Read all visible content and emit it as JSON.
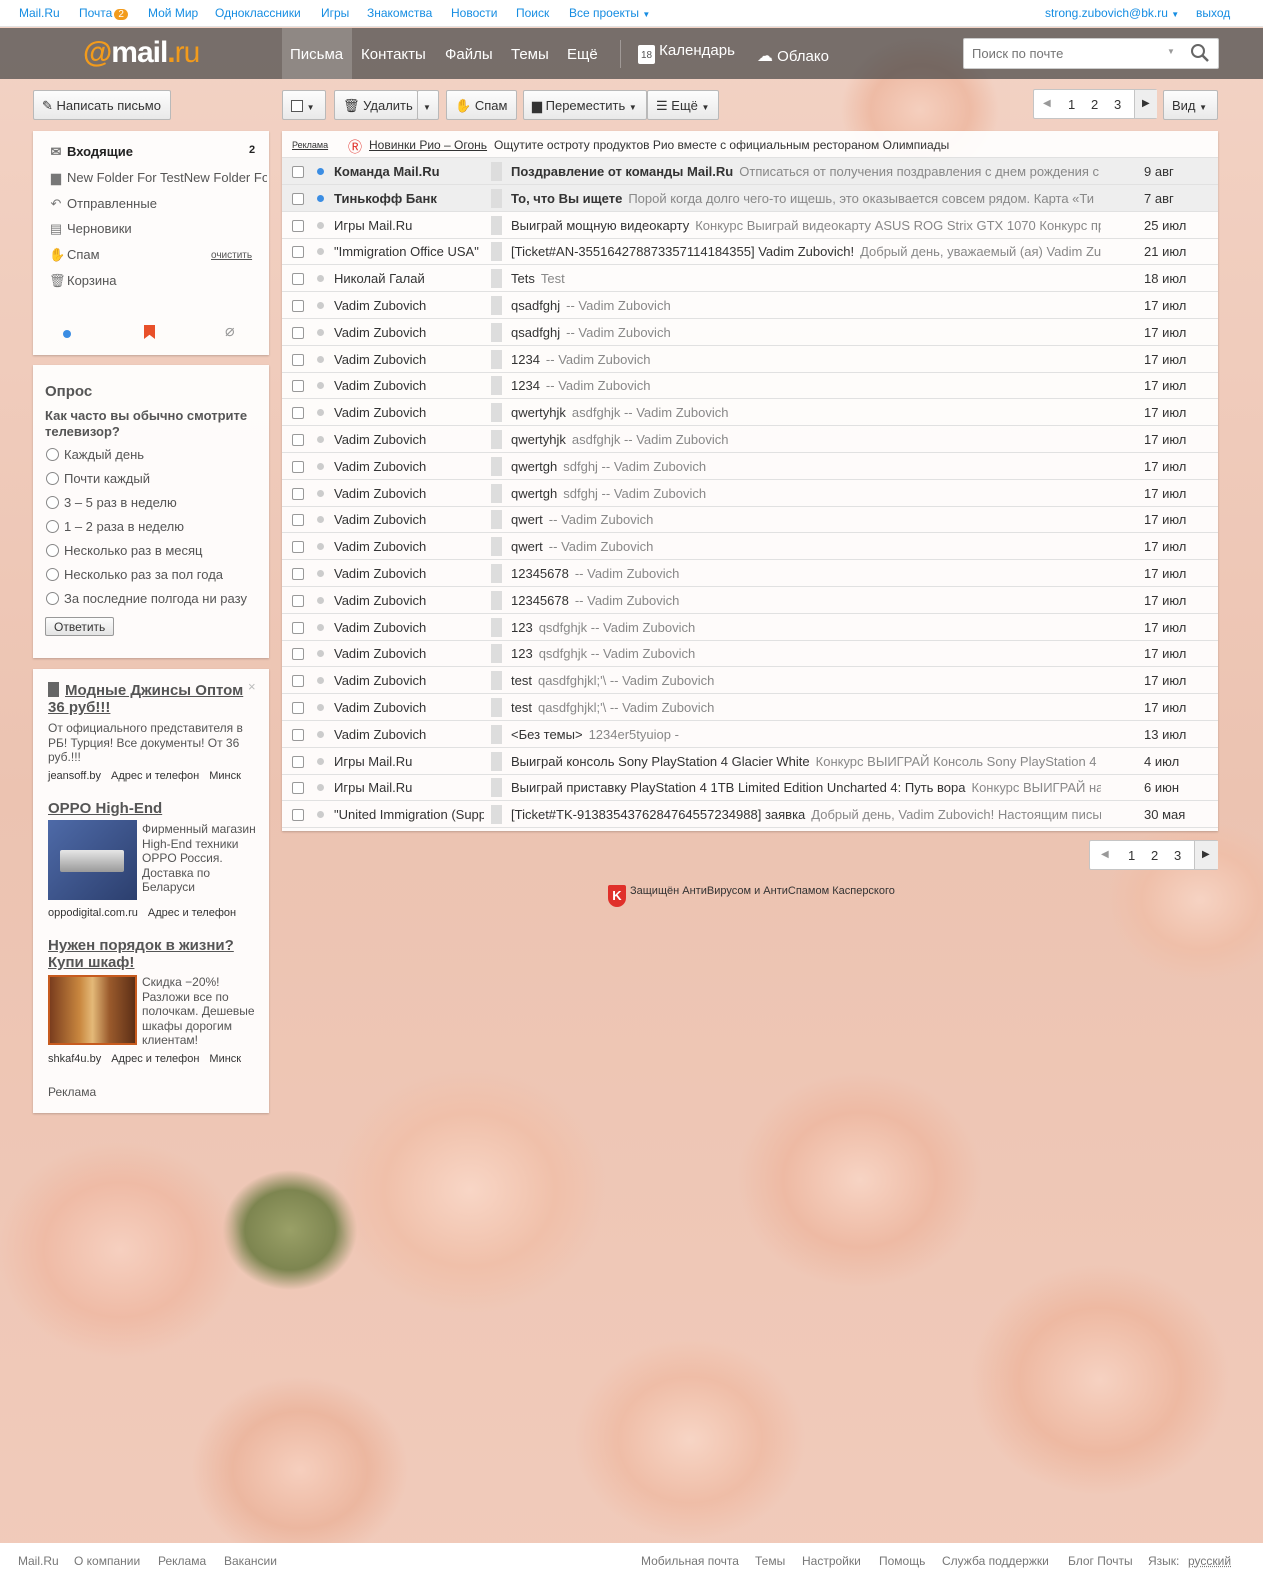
{
  "topbar": {
    "mailru": "Mail.Ru",
    "pochta": "Почта",
    "pochta_count": "2",
    "moy_mir": "Мой Мир",
    "ok": "Одноклассники",
    "igry": "Игры",
    "znakomstva": "Знакомства",
    "novosti": "Новости",
    "poisk": "Поиск",
    "vse_proekty": "Все проекты",
    "user": "strong.zubovich@bk.ru",
    "logout": "выход"
  },
  "header": {
    "logo_at": "@",
    "logo_mail": "mail",
    "logo_dot": ".",
    "logo_ru": "ru",
    "nav": [
      "Письма",
      "Контакты",
      "Файлы",
      "Темы",
      "Ещё"
    ],
    "calendar": "Календарь",
    "calendar_day": "18",
    "cloud": "Облако",
    "search_placeholder": "Поиск по почте"
  },
  "toolbar": {
    "compose": "Написать письмо",
    "delete": "Удалить",
    "spam": "Спам",
    "move": "Переместить",
    "more": "Ещё",
    "view": "Вид",
    "pages": [
      "1",
      "2",
      "3"
    ]
  },
  "folders": [
    {
      "icon": "envelope-icon",
      "label": "Входящие",
      "count": "2"
    },
    {
      "icon": "folder-icon",
      "label": "New Folder For TestNew Folder For Test"
    },
    {
      "icon": "reply-icon",
      "label": "Отправленные"
    },
    {
      "icon": "draft-icon",
      "label": "Черновики"
    },
    {
      "icon": "spam-icon",
      "label": "Спам",
      "action": "очистить"
    },
    {
      "icon": "trash-icon",
      "label": "Корзина"
    }
  ],
  "poll": {
    "title": "Опрос",
    "question": "Как часто вы обычно смотрите телевизор?",
    "options": [
      "Каждый день",
      "Почти каждый",
      "3 – 5 раз в неделю",
      "1 – 2 раза в неделю",
      "Несколько раз в месяц",
      "Несколько раз за пол года",
      "За последние полгода ни разу"
    ],
    "submit": "Ответить"
  },
  "ads": [
    {
      "title": "Модные Джинсы Оптом 36 руб!!!",
      "text": "От официального представителя в РБ! Турция! Все документы! От 36 руб.!!!",
      "site": "jeansoff.by",
      "addr": "Адрес и телефон",
      "city": "Минск"
    },
    {
      "title": "OPPO High-End",
      "text": "Фирменный магазин High-End техники OPPO Россия. Доставка по Беларуси",
      "site": "oppodigital.com.ru",
      "addr": "Адрес и телефон"
    },
    {
      "title": "Нужен порядок в жизни? Купи шкаф!",
      "text": "Скидка −20%! Разложи все по полочкам. Дешевые шкафы дорогим клиентам!",
      "site": "shkaf4u.by",
      "addr": "Адрес и телефон",
      "city": "Минск"
    }
  ],
  "ads_label": "Реклама",
  "promo": {
    "label": "Реклама",
    "link": "Новинки Рио – Огонь",
    "text": "Ощутите остроту продуктов Рио вместе с официальным рестораном Олимпиады"
  },
  "messages": [
    {
      "from": "Команда Mail.Ru",
      "subject": "Поздравление от команды Mail.Ru",
      "snippet": "Отписаться от получения поздравления с днем рождения с",
      "date": "9 авг",
      "unread": true
    },
    {
      "from": "Тинькофф Банк",
      "subject": "То, что Вы ищете",
      "snippet": "Порой когда долго чего-то ищешь, это оказывается совсем рядом. Карта «Ти",
      "date": "7 авг",
      "unread": true
    },
    {
      "from": "Игры Mail.Ru",
      "subject": "Выиграй мощную видеокарту",
      "snippet": "Конкурс Выиграй видеокарту ASUS ROG Strix GTX 1070 Конкурс пр",
      "date": "25 июл",
      "unread": false
    },
    {
      "from": "\"Immigration Office USA\"",
      "subject": "[Ticket#AN-3551642788733571141843​55] Vadim Zubovich!",
      "snippet": "Добрый день, уважаемый (ая) Vadim Zubo",
      "date": "21 июл",
      "unread": false
    },
    {
      "from": "Николай Галай",
      "subject": "Tets",
      "snippet": "Test",
      "date": "18 июл",
      "unread": false
    },
    {
      "from": "Vadim Zubovich",
      "subject": "qsadfghj",
      "snippet": "-- Vadim Zubovich",
      "date": "17 июл",
      "unread": false
    },
    {
      "from": "Vadim Zubovich",
      "subject": "qsadfghj",
      "snippet": "-- Vadim Zubovich",
      "date": "17 июл",
      "unread": false
    },
    {
      "from": "Vadim Zubovich",
      "subject": "1234",
      "snippet": "-- Vadim Zubovich",
      "date": "17 июл",
      "unread": false
    },
    {
      "from": "Vadim Zubovich",
      "subject": "1234",
      "snippet": "-- Vadim Zubovich",
      "date": "17 июл",
      "unread": false
    },
    {
      "from": "Vadim Zubovich",
      "subject": "qwertyhjk",
      "snippet": "asdfghjk -- Vadim Zubovich",
      "date": "17 июл",
      "unread": false
    },
    {
      "from": "Vadim Zubovich",
      "subject": "qwertyhjk",
      "snippet": "asdfghjk -- Vadim Zubovich",
      "date": "17 июл",
      "unread": false
    },
    {
      "from": "Vadim Zubovich",
      "subject": "qwertgh",
      "snippet": "sdfghj -- Vadim Zubovich",
      "date": "17 июл",
      "unread": false
    },
    {
      "from": "Vadim Zubovich",
      "subject": "qwertgh",
      "snippet": "sdfghj -- Vadim Zubovich",
      "date": "17 июл",
      "unread": false
    },
    {
      "from": "Vadim Zubovich",
      "subject": "qwert",
      "snippet": "-- Vadim Zubovich",
      "date": "17 июл",
      "unread": false
    },
    {
      "from": "Vadim Zubovich",
      "subject": "qwert",
      "snippet": "-- Vadim Zubovich",
      "date": "17 июл",
      "unread": false
    },
    {
      "from": "Vadim Zubovich",
      "subject": "12345678",
      "snippet": "-- Vadim Zubovich",
      "date": "17 июл",
      "unread": false
    },
    {
      "from": "Vadim Zubovich",
      "subject": "12345678",
      "snippet": "-- Vadim Zubovich",
      "date": "17 июл",
      "unread": false
    },
    {
      "from": "Vadim Zubovich",
      "subject": "123",
      "snippet": "qsdfghjk -- Vadim Zubovich",
      "date": "17 июл",
      "unread": false
    },
    {
      "from": "Vadim Zubovich",
      "subject": "123",
      "snippet": "qsdfghjk -- Vadim Zubovich",
      "date": "17 июл",
      "unread": false
    },
    {
      "from": "Vadim Zubovich",
      "subject": "test",
      "snippet": "qasdfghjkl;'\\ -- Vadim Zubovich",
      "date": "17 июл",
      "unread": false
    },
    {
      "from": "Vadim Zubovich",
      "subject": "test",
      "snippet": "qasdfghjkl;'\\ -- Vadim Zubovich",
      "date": "17 июл",
      "unread": false
    },
    {
      "from": "Vadim Zubovich",
      "subject": "<Без темы>",
      "snippet": "1234er5tyuiop -",
      "date": "13 июл",
      "unread": false
    },
    {
      "from": "Игры Mail.Ru",
      "subject": "Выиграй консоль Sony PlayStation 4 Glacier White",
      "snippet": "Конкурс ВЫИГРАЙ Консоль Sony PlayStation 4",
      "date": "4 июл",
      "unread": false
    },
    {
      "from": "Игры Mail.Ru",
      "subject": "Выиграй приставку PlayStation 4 1TB Limited Edition Uncharted 4: Путь вора",
      "snippet": "Конкурс ВЫИГРАЙ на",
      "date": "6 июн",
      "unread": false
    },
    {
      "from": "\"United Immigration (Support)\"",
      "subject": "[Ticket#TK-913835437628476455723​4988] заявка",
      "snippet": "Добрый день, Vadim Zubovich! Настоящим письм",
      "date": "30 мая",
      "unread": false
    }
  ],
  "kaspersky": {
    "prefix": "Защищён",
    "av": "АнтиВирусом",
    "and": "и",
    "as": "АнтиСпамом",
    "suffix": "Касперского"
  },
  "footer": {
    "left": [
      "Mail.Ru",
      "О компании",
      "Реклама",
      "Вакансии"
    ],
    "right": [
      "Мобильная почта",
      "Темы",
      "Настройки",
      "Помощь",
      "Служба поддержки",
      "Блог Почты"
    ],
    "lang_label": "Язык:",
    "lang": "русский"
  }
}
